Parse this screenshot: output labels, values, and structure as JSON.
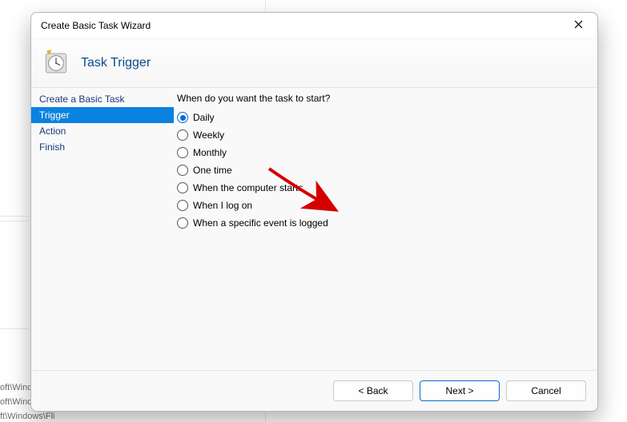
{
  "bg": {
    "line1": "oft\\Winc",
    "line2": "oft\\Windows\\O...",
    "line3": "ft\\Windows\\Fli"
  },
  "dialog": {
    "title": "Create Basic Task Wizard",
    "banner_title": "Task Trigger"
  },
  "steps": [
    {
      "label": "Create a Basic Task",
      "active": false
    },
    {
      "label": "Trigger",
      "active": true
    },
    {
      "label": "Action",
      "active": false
    },
    {
      "label": "Finish",
      "active": false
    }
  ],
  "content": {
    "question": "When do you want the task to start?",
    "options": [
      {
        "label": "Daily",
        "selected": true
      },
      {
        "label": "Weekly",
        "selected": false
      },
      {
        "label": "Monthly",
        "selected": false
      },
      {
        "label": "One time",
        "selected": false
      },
      {
        "label": "When the computer starts",
        "selected": false
      },
      {
        "label": "When I log on",
        "selected": false
      },
      {
        "label": "When a specific event is logged",
        "selected": false
      }
    ]
  },
  "footer": {
    "back": "< Back",
    "next": "Next >",
    "cancel": "Cancel"
  }
}
